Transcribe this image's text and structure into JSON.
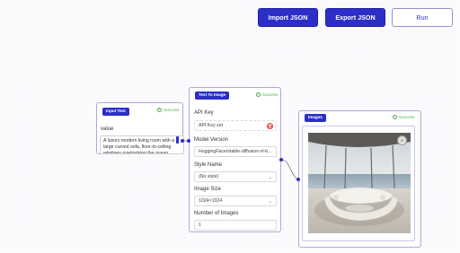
{
  "toolbar": {
    "import_label": "Import JSON",
    "export_label": "Export JSON",
    "run_label": "Run"
  },
  "input_node": {
    "tag": "Input Text",
    "status": "Success",
    "value_label": "value",
    "value_text": "A luxury modern living room with a large curved sofa, floor-to-ceiling windows overlooking the ocean"
  },
  "t2i_node": {
    "tag": "Text To Image",
    "status": "Success",
    "api_key_label": "API Key",
    "api_key_value": "API Key set",
    "model_label": "Model Version",
    "model_value": "HuggingFace/stable-diffusion-xl-b...",
    "style_label": "Style Name",
    "style_value": "(No style)",
    "size_label": "Image Size",
    "size_value": "1024×1024",
    "count_label": "Number of Images",
    "count_value": "1"
  },
  "images_node": {
    "tag": "Images",
    "status": "Success"
  },
  "icons": {
    "status": "check-circle-icon",
    "delete": "trash-icon",
    "zoom": "zoom-icon",
    "dropdown": "chevron-down-icon"
  }
}
